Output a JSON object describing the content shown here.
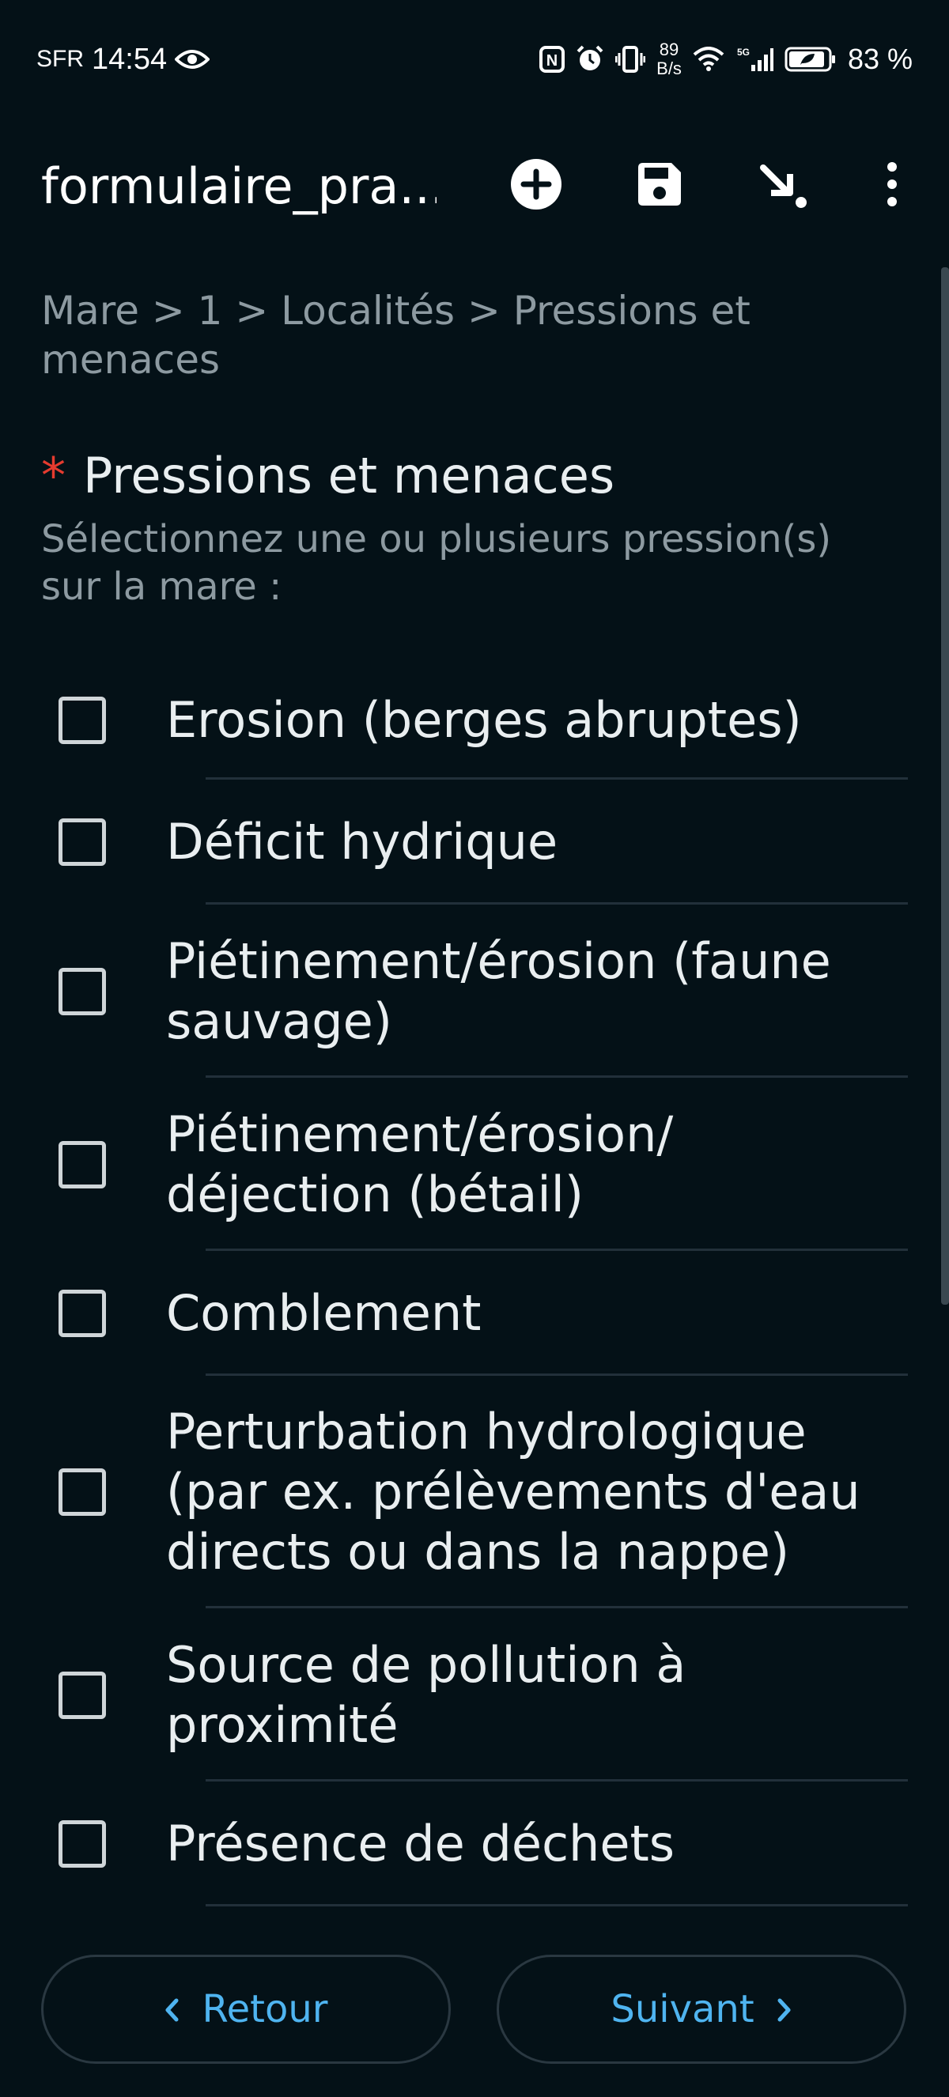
{
  "status_bar": {
    "carrier": "SFR",
    "time": "14:54",
    "net_speed_value": "89",
    "net_speed_unit": "B/s",
    "battery": "83 %",
    "icons": [
      "eye-icon",
      "nfc-icon",
      "alarm-icon",
      "vibrate-icon",
      "wifi-icon",
      "signal-5g-icon",
      "battery-icon"
    ]
  },
  "app_bar": {
    "title": "formulaire_pra...",
    "actions": [
      "add-circle-icon",
      "save-icon",
      "download-arrow-icon",
      "more-vert-icon"
    ]
  },
  "breadcrumb": "Mare > 1 > Localités > Pressions et menaces",
  "question": {
    "required_mark": "*",
    "title": "Pressions et menaces",
    "hint": "Sélectionnez une ou plusieurs pression(s) sur la mare :"
  },
  "options": [
    {
      "label": "Erosion (berges abruptes)",
      "checked": false
    },
    {
      "label": "Déficit hydrique",
      "checked": false
    },
    {
      "label": "Piétinement/érosion (faune sauvage)",
      "checked": false
    },
    {
      "label": "Piétinement/érosion/ déjection (bétail)",
      "checked": false
    },
    {
      "label": "Comblement",
      "checked": false
    },
    {
      "label": "Perturbation hydrologique (par ex. prélèvements d'eau directs ou dans la nappe)",
      "checked": false
    },
    {
      "label": "Source de pollution à proximité",
      "checked": false
    },
    {
      "label": "Présence de déchets",
      "checked": false
    }
  ],
  "nav": {
    "back_label": "Retour",
    "next_label": "Suivant"
  },
  "colors": {
    "background": "#041117",
    "accent": "#4fb4f0",
    "required": "#e53b2f",
    "muted_text": "#8d9aa1"
  }
}
